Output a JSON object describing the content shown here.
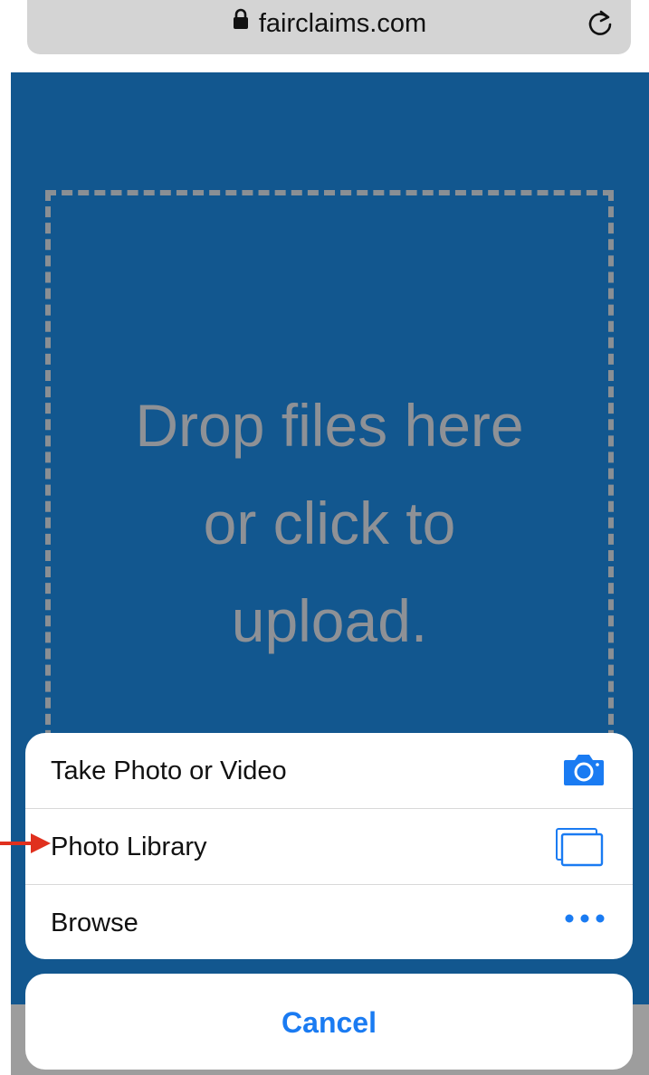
{
  "browser": {
    "url": "fairclaims.com",
    "lock_icon": "lock-icon",
    "reload_icon": "reload-icon"
  },
  "page": {
    "background_color": "#12578f",
    "dropzone_line1": "Drop files here",
    "dropzone_line2": "or click to",
    "dropzone_line3": "upload."
  },
  "action_sheet": {
    "items": [
      {
        "label": "Take Photo or Video",
        "icon": "camera-icon"
      },
      {
        "label": "Photo Library",
        "icon": "photo-library-icon"
      },
      {
        "label": "Browse",
        "icon": "more-icon"
      }
    ],
    "cancel_label": "Cancel",
    "accent_color": "#1a7bf2"
  },
  "annotation": {
    "arrow_color": "#e0301e",
    "arrow_target": "Photo Library"
  }
}
